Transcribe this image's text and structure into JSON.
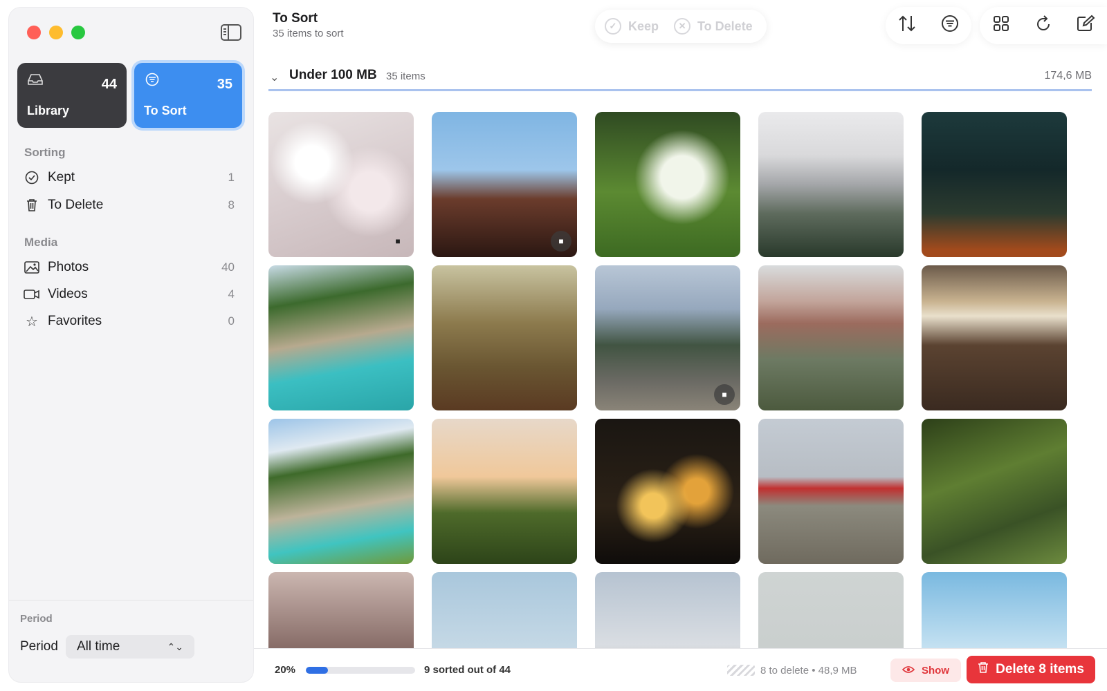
{
  "sidebar": {
    "cards": [
      {
        "label": "Library",
        "count": "44"
      },
      {
        "label": "To Sort",
        "count": "35"
      }
    ],
    "sorting": {
      "title": "Sorting",
      "items": [
        {
          "label": "Kept",
          "count": "1"
        },
        {
          "label": "To Delete",
          "count": "8"
        }
      ]
    },
    "media": {
      "title": "Media",
      "items": [
        {
          "label": "Photos",
          "count": "40"
        },
        {
          "label": "Videos",
          "count": "4"
        },
        {
          "label": "Favorites",
          "count": "0"
        }
      ]
    },
    "period": {
      "title": "Period",
      "label": "Period",
      "value": "All time"
    }
  },
  "header": {
    "title": "To Sort",
    "subtitle": "35 items to sort",
    "keep_label": "Keep",
    "to_delete_label": "To Delete"
  },
  "toolbar": {
    "icons": [
      "sort-icon",
      "filter-icon",
      "grid-icon",
      "refresh-icon",
      "compose-icon"
    ]
  },
  "group": {
    "name": "Under 100 MB",
    "count": "35 items",
    "size": "174,6 MB"
  },
  "bottom": {
    "percent": "20%",
    "progress": 0.2,
    "sorted_text": "9 sorted out of 44",
    "to_delete_info": "8 to delete • 48,9 MB",
    "show_label": "Show",
    "delete_label": "Delete 8 items"
  },
  "colors": {
    "accent": "#3d8ef0",
    "danger": "#e8353b",
    "library_card": "#3b3b3f"
  }
}
